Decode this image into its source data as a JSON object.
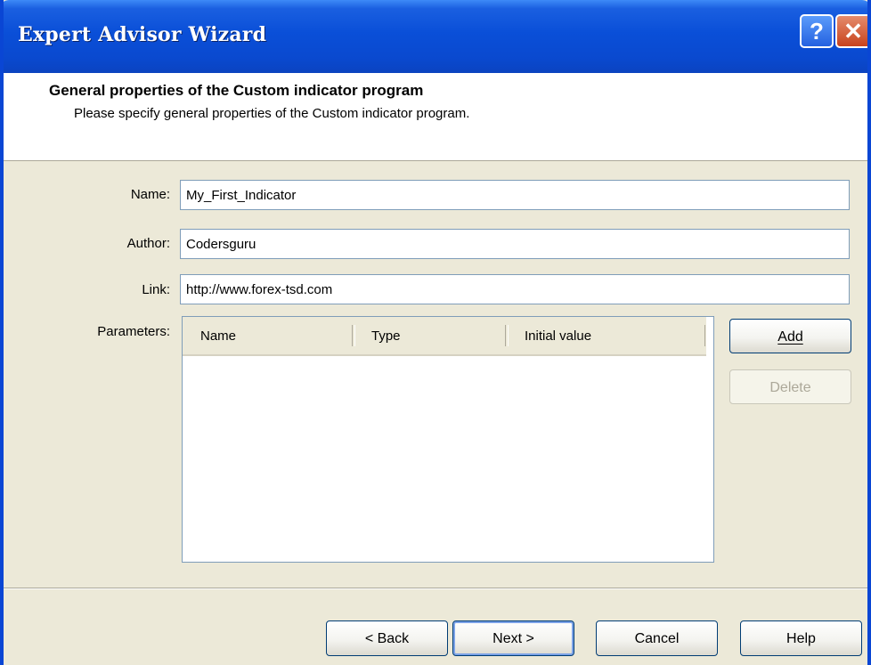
{
  "window": {
    "title": "Expert Advisor Wizard",
    "help_glyph": "?",
    "close_glyph": "✕"
  },
  "header": {
    "title": "General properties of the Custom indicator program",
    "subtitle": "Please specify general properties of the Custom indicator program."
  },
  "form": {
    "name_label": "Name:",
    "name_value": "My_First_Indicator",
    "author_label": "Author:",
    "author_value": "Codersguru",
    "link_label": "Link:",
    "link_value": "http://www.forex-tsd.com",
    "parameters_label": "Parameters:"
  },
  "parameters_table": {
    "columns": [
      "Name",
      "Type",
      "Initial value"
    ],
    "rows": []
  },
  "side_buttons": {
    "add_label": "Add",
    "delete_label": "Delete"
  },
  "footer": {
    "back_label": "< Back",
    "next_label": "Next >",
    "cancel_label": "Cancel",
    "help_label": "Help"
  },
  "colors": {
    "titlebar": "#0a4fd8",
    "dialog_face": "#ece9d8",
    "input_border": "#7f9db9"
  }
}
